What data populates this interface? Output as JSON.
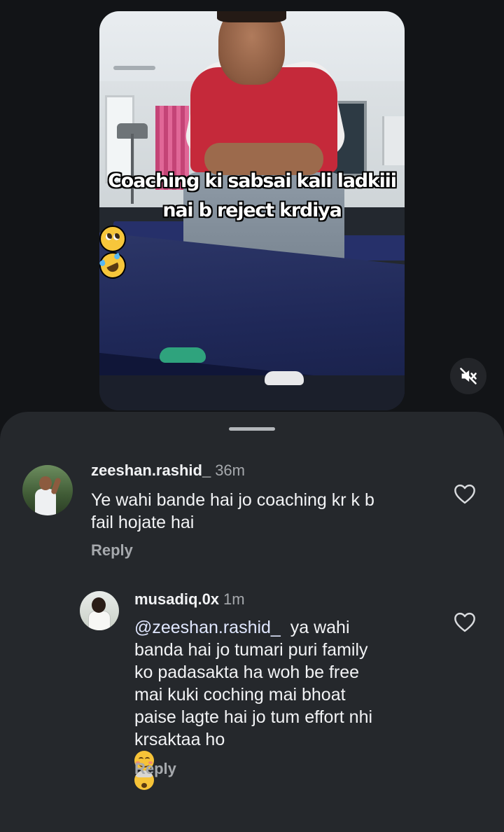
{
  "video": {
    "caption_line1": "Coaching ki sabsai kali ladkiii",
    "caption_line2": "nai b reject krdiya",
    "caption_emojis": [
      "pleading-face",
      "rolling-on-floor-laughing"
    ],
    "mute_icon": "speaker-muted-icon"
  },
  "comments": [
    {
      "username": "zeeshan.rashid_",
      "time": "36m",
      "text_lines": [
        "Ye wahi bande hai jo coaching kr k b",
        "fail hojate hai"
      ],
      "reply_label": "Reply",
      "like_icon": "heart-outline-icon"
    },
    {
      "username": "musadiq.0x",
      "time": "1m",
      "mention": "@zeeshan.rashid_",
      "text_first": "  ya wahi",
      "text_lines": [
        "banda hai jo tumari puri family",
        "ko padasakta ha woh be free",
        "mai kuki coching mai bhoat",
        "paise lagte hai jo tum effort nhi",
        "krsaktaa ho"
      ],
      "trailing_emojis": [
        "smiling-face-with-smiling-eyes",
        "exploding-head"
      ],
      "reply_label": "Reply",
      "like_icon": "heart-outline-icon"
    }
  ],
  "colors": {
    "background": "#121417",
    "sheet": "#25282c",
    "text_primary": "#f2f3f5",
    "text_secondary": "#a6a9ad"
  }
}
